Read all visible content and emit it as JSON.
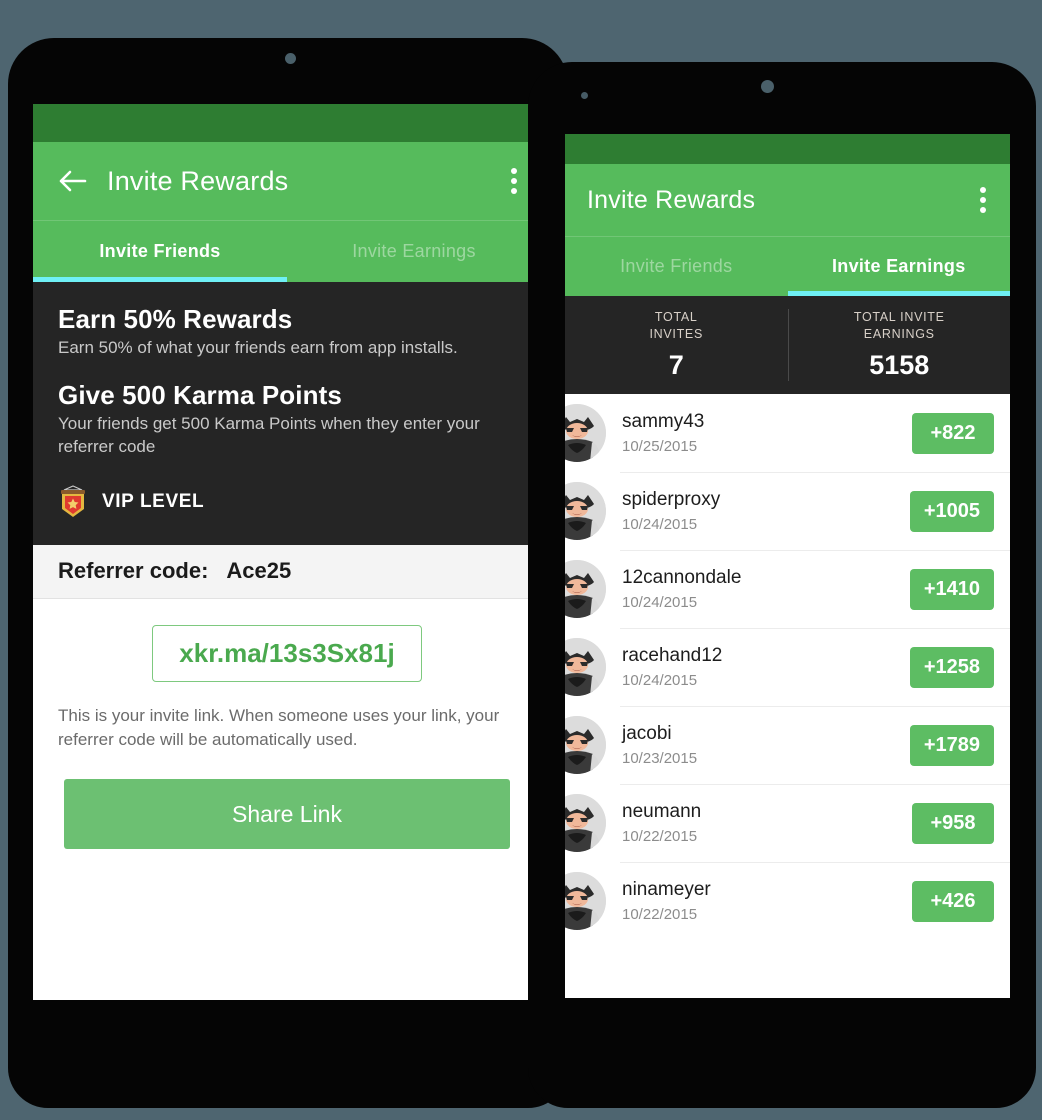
{
  "background_color": "#4e6570",
  "colors": {
    "status_bar_green": "#2e7d32",
    "app_bar_green": "#56bb5c",
    "accent_cyan": "#6ff0f5",
    "button_green": "#6cc072",
    "badge_green": "#5dbd63",
    "link_green": "#4aa94e",
    "dark_panel": "#252525"
  },
  "phone_left": {
    "icons": {
      "back": "arrow-left-icon",
      "overflow": "overflow-menu-icon",
      "vip": "vip-shield-icon"
    },
    "appbar": {
      "title": "Invite Rewards"
    },
    "tabs": [
      {
        "label": "Invite Friends",
        "active": true
      },
      {
        "label": "Invite Earnings",
        "active": false
      }
    ],
    "promo": {
      "heading1": "Earn 50% Rewards",
      "body1": "Earn 50% of what your friends earn from app installs.",
      "heading2": "Give 500 Karma Points",
      "body2": "Your friends get 500 Karma Points when they enter your referrer code",
      "vip_label": "VIP LEVEL"
    },
    "referrer": {
      "label": "Referrer code:",
      "code": "Ace25"
    },
    "invite_link": {
      "url": "xkr.ma/13s3Sx81j",
      "note": "This is your invite link. When someone uses your link, your referrer code will be automatically used.",
      "share_button": "Share Link"
    }
  },
  "phone_right": {
    "icons": {
      "overflow": "overflow-menu-icon",
      "avatar": "batman-avatar-icon"
    },
    "appbar": {
      "title": "Invite Rewards"
    },
    "tabs": [
      {
        "label": "Invite Friends",
        "active": false
      },
      {
        "label": "Invite Earnings",
        "active": true
      }
    ],
    "stats": [
      {
        "label": "TOTAL\nINVITES",
        "value": "7"
      },
      {
        "label": "TOTAL INVITE\nEARNINGS",
        "value": "5158"
      }
    ],
    "invites": [
      {
        "name": "sammy43",
        "date": "10/25/2015",
        "amount": "+822"
      },
      {
        "name": "spiderproxy",
        "date": "10/24/2015",
        "amount": "+1005"
      },
      {
        "name": "12cannondale",
        "date": "10/24/2015",
        "amount": "+1410"
      },
      {
        "name": "racehand12",
        "date": "10/24/2015",
        "amount": "+1258"
      },
      {
        "name": "jacobi",
        "date": "10/23/2015",
        "amount": "+1789"
      },
      {
        "name": "neumann",
        "date": "10/22/2015",
        "amount": "+958"
      },
      {
        "name": "ninameyer",
        "date": "10/22/2015",
        "amount": "+426"
      }
    ]
  }
}
